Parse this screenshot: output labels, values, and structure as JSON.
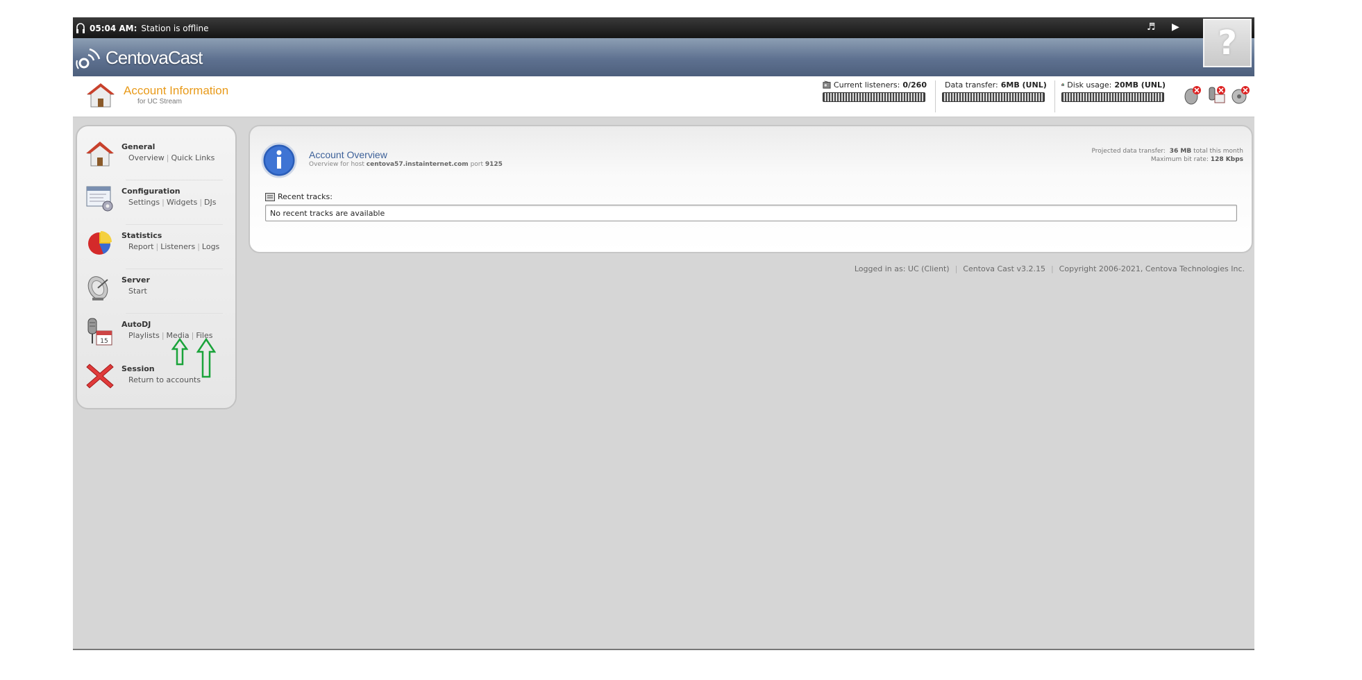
{
  "status_bar": {
    "time": "05:04 AM:",
    "message": "Station is offline",
    "icons": [
      "headphones-icon",
      "music-note-icon",
      "play-icon"
    ]
  },
  "brand": {
    "logo_text": "CentovaCast",
    "help_label": "?"
  },
  "header": {
    "title": "Account Information",
    "subtitle": "for UC Stream",
    "meters": [
      {
        "label": "Current listeners:",
        "value": "0/260",
        "fill": 0
      },
      {
        "label": "Data transfer:",
        "value": "6MB (UNL)",
        "fill": 0
      },
      {
        "label": "Disk usage:",
        "value": "20MB (UNL)",
        "fill": 0
      }
    ],
    "tools": [
      "stop-server-icon",
      "stop-autodj-icon",
      "stop-stream-icon"
    ]
  },
  "sidebar": {
    "groups": [
      {
        "title": "General",
        "icon": "house-icon",
        "links": [
          "Overview",
          "Quick Links"
        ]
      },
      {
        "title": "Configuration",
        "icon": "settings-window-icon",
        "links": [
          "Settings",
          "Widgets",
          "DJs"
        ]
      },
      {
        "title": "Statistics",
        "icon": "pie-chart-icon",
        "links": [
          "Report",
          "Listeners",
          "Logs"
        ]
      },
      {
        "title": "Server",
        "icon": "satellite-dish-icon",
        "links": [
          "Start"
        ]
      },
      {
        "title": "AutoDJ",
        "icon": "microphone-calendar-icon",
        "links": [
          "Playlists",
          "Media",
          "Files"
        ]
      },
      {
        "title": "Session",
        "icon": "red-x-icon",
        "links": [
          "Return to accounts"
        ]
      }
    ]
  },
  "main": {
    "title": "Account Overview",
    "subtitle_prefix": "Overview for host",
    "host": "centova57.instainternet.com",
    "port_label": "port",
    "port": "9125",
    "projected_label": "Projected data transfer:",
    "projected_value": "36 MB",
    "projected_suffix": "total this month",
    "bitrate_label": "Maximum bit rate:",
    "bitrate_value": "128 Kbps",
    "recent_label": "Recent tracks:",
    "recent_empty": "No recent tracks are available"
  },
  "footer": {
    "logged_in": "Logged in as: UC (Client)",
    "version": "Centova Cast v3.2.15",
    "copyright": "Copyright 2006-2021, Centova Technologies Inc."
  },
  "colors": {
    "title_orange": "#e89a1a",
    "panel_title_blue": "#3d6199",
    "annotation_green": "#1aa33a"
  }
}
